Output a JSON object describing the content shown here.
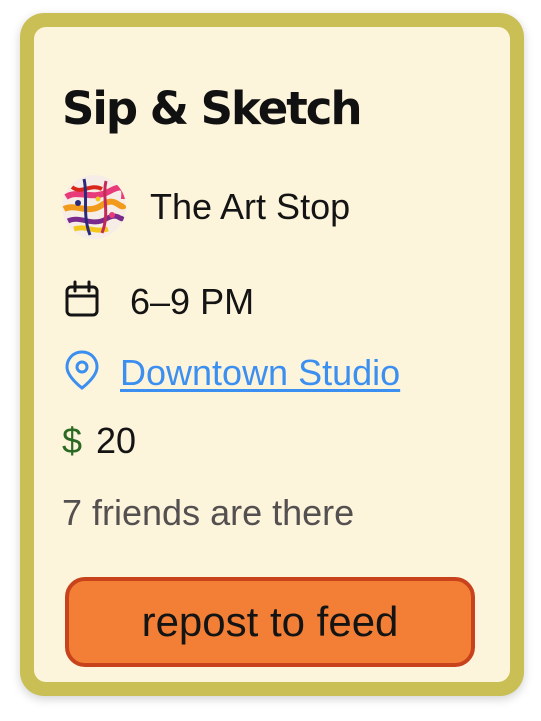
{
  "event": {
    "title": "Sip & Sketch",
    "host_name": "The Art Stop",
    "time": "6–9 PM",
    "location": "Downtown Studio",
    "price_symbol": "$",
    "price": "20",
    "friends_text": "7 friends are there"
  },
  "actions": {
    "repost_label": "repost to feed"
  },
  "icons": {
    "time": "calendar-icon",
    "location": "map-pin-icon"
  },
  "colors": {
    "card_border": "#c9bf55",
    "card_background": "#fdf4dc",
    "link": "#3b8ff0",
    "price_symbol": "#2a6a23",
    "button_fill": "#f27f35",
    "button_border": "#c8431c"
  }
}
